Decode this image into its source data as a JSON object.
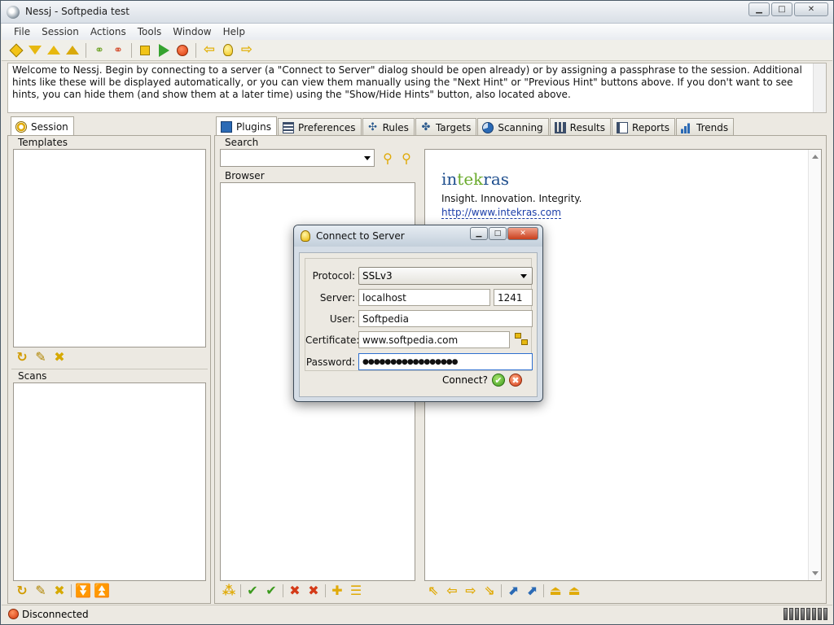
{
  "window": {
    "title": "Nessj - Softpedia test",
    "minimize_glyph": "▁",
    "maximize_glyph": "□",
    "close_glyph": "✕"
  },
  "menu": [
    "File",
    "Session",
    "Actions",
    "Tools",
    "Window",
    "Help"
  ],
  "hint_text": "Welcome to Nessj. Begin by connecting to a server (a \"Connect to Server\" dialog should be open already) or by assigning a passphrase to the session. Additional hints like these will be displayed automatically, or you can view them manually using the \"Next Hint\" or \"Previous Hint\" buttons above. If you don't want to see hints, you can hide them (and show them at a later time) using the \"Show/Hide Hints\" button, also located above.",
  "left_panel": {
    "tab": "Session",
    "templates_label": "Templates",
    "scans_label": "Scans"
  },
  "main_tabs": [
    "Plugins",
    "Preferences",
    "Rules",
    "Targets",
    "Scanning",
    "Results",
    "Reports",
    "Trends"
  ],
  "plugins": {
    "search_label": "Search",
    "browser_label": "Browser"
  },
  "content": {
    "brand_pre": "in",
    "brand_mid": "tek",
    "brand_post": "ras",
    "tagline": "Insight. Innovation. Integrity.",
    "url": "http://www.intekras.com"
  },
  "status": {
    "text": "Disconnected",
    "color": "#d3350b"
  },
  "dialog": {
    "title": "Connect to Server",
    "protocol_label": "Protocol:",
    "protocol_value": "SSLv3",
    "server_label": "Server:",
    "server_value": "localhost",
    "port_value": "1241",
    "user_label": "User:",
    "user_value": "Softpedia",
    "certificate_label": "Certificate:",
    "certificate_value": "www.softpedia.com",
    "password_label": "Password:",
    "password_value": "●●●●●●●●●●●●●●●●●",
    "connect_label": "Connect?"
  },
  "colors": {
    "accent_yellow": "#f2c416",
    "ok_green": "#3c9a1e",
    "cancel_red": "#d43a18",
    "brand_blue": "#1f4f8e",
    "brand_green": "#6aab2c"
  }
}
